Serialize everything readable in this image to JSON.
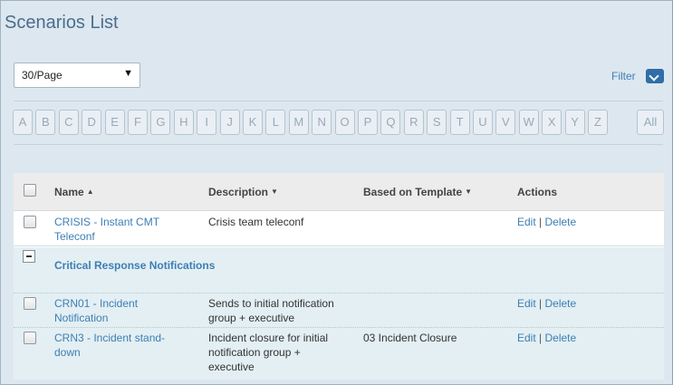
{
  "page": {
    "title": "Scenarios List"
  },
  "controls": {
    "per_page": "30/Page",
    "filter_label": "Filter"
  },
  "alphabet": [
    "A",
    "B",
    "C",
    "D",
    "E",
    "F",
    "G",
    "H",
    "I",
    "J",
    "K",
    "L",
    "M",
    "N",
    "O",
    "P",
    "Q",
    "R",
    "S",
    "T",
    "U",
    "V",
    "W",
    "X",
    "Y",
    "Z"
  ],
  "alphabet_all": "All",
  "table": {
    "columns": {
      "name": "Name",
      "description": "Description",
      "template": "Based on Template",
      "actions": "Actions"
    },
    "sort_indicators": {
      "name": "▲",
      "description": "▼",
      "template": "▼"
    },
    "rows": [
      {
        "name": "CRISIS - Instant CMT Teleconf",
        "description": "Crisis team teleconf",
        "template": "",
        "edit": "Edit",
        "sep": "|",
        "delete": "Delete"
      }
    ],
    "group": {
      "label": "Critical Response Notifications",
      "rows": [
        {
          "name": "CRN01 - Incident Notification",
          "description": "Sends to initial notification group + executive",
          "template": "",
          "edit": "Edit",
          "sep": "|",
          "delete": "Delete"
        },
        {
          "name": "CRN3 - Incident stand-down",
          "description": "Incident closure for initial notification group + executive",
          "template": "03 Incident Closure",
          "edit": "Edit",
          "sep": "|",
          "delete": "Delete"
        }
      ]
    }
  }
}
